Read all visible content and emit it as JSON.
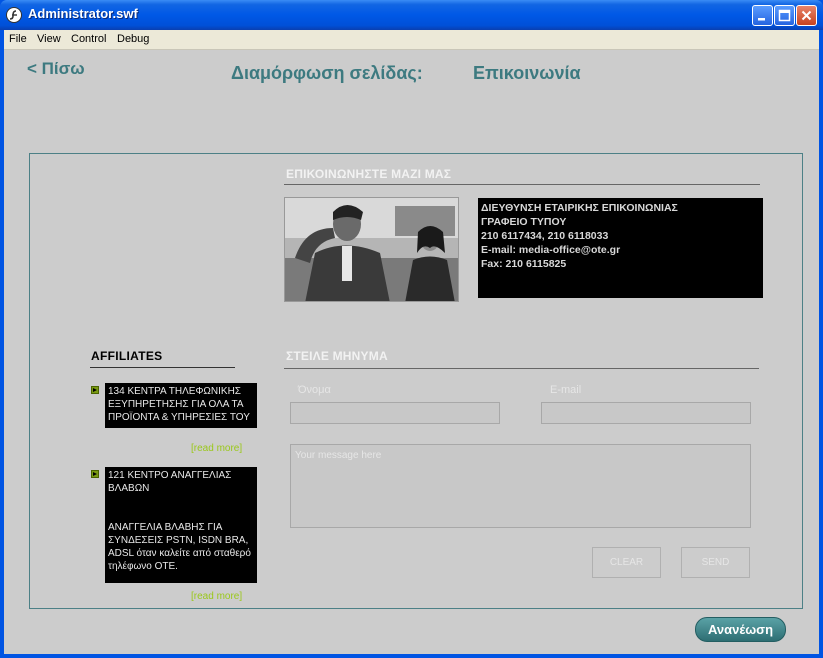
{
  "window": {
    "title": "Administrator.swf"
  },
  "menu": [
    "File",
    "View",
    "Control",
    "Debug"
  ],
  "header": {
    "back": "< Πίσω",
    "title": "Διαμόρφωση σελίδας:",
    "page": "Επικοινωνία"
  },
  "contact_section": {
    "heading": "ΕΠΙΚΟΙΝΩΝΗΣΤΕ ΜΑΖΙ ΜΑΣ",
    "lines": [
      "ΔΙΕΥΘΥΝΣΗ ΕΤΑΙΡΙΚΗΣ ΕΠΙΚΟΙΝΩΝΙΑΣ",
      "ΓΡΑΦΕΙΟ ΤΥΠΟΥ",
      "210 6117434, 210 6118033",
      "E-mail: media-office@ote.gr",
      "Fax: 210 6115825"
    ]
  },
  "affiliates": {
    "heading": "AFFILIATES",
    "items": [
      {
        "text": "134 ΚΕΝΤΡΑ ΤΗΛΕΦΩΝΙΚΗΣ ΕΞΥΠΗΡΕΤΗΣΗΣ ΓΙΑ ΟΛΑ ΤΑ ΠΡΟΪΟΝΤΑ & ΥΠΗΡΕΣΙΕΣ ΤΟΥ",
        "read_more": "[read more]"
      },
      {
        "text": "121 ΚΕΝΤΡΟ ΑΝΑΓΓΕΛΙΑΣ ΒΛΑΒΩΝ",
        "detail": "ΑΝΑΓΓΕΛΙΑ ΒΛΑΒΗΣ ΓΙΑ ΣΥΝΔΕΣΕΙΣ PSTN, ISDN BRA, ADSL όταν καλείτε από σταθερό τηλέφωνο ΟΤΕ.",
        "read_more": "[read more]"
      }
    ]
  },
  "message_section": {
    "heading": "ΣΤΕΙΛΕ ΜΗΝΥΜΑ",
    "name_label": "Όνομα",
    "email_label": "E-mail",
    "message_placeholder": "Your message here",
    "clear": "CLEAR",
    "send": "SEND"
  },
  "refresh": "Ανανέωση",
  "colors": {
    "accent": "#3d7a80",
    "link_green": "#9ac81a"
  }
}
